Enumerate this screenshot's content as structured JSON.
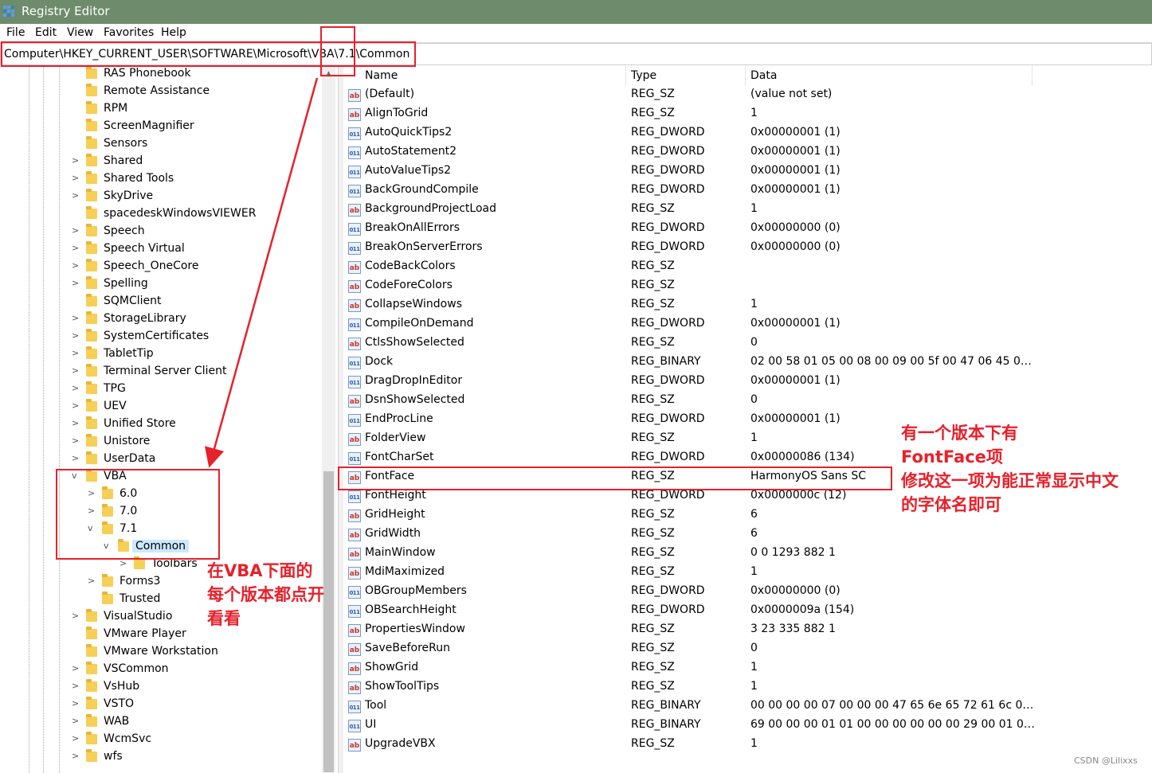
{
  "window": {
    "title": "Registry Editor"
  },
  "menu": [
    "File",
    "Edit",
    "View",
    "Favorites",
    "Help"
  ],
  "address": "Computer\\HKEY_CURRENT_USER\\SOFTWARE\\Microsoft\\VBA\\7.1\\Common",
  "tree": [
    {
      "label": "RAS Phonebook",
      "expandable": false
    },
    {
      "label": "Remote Assistance",
      "expandable": false
    },
    {
      "label": "RPM",
      "expandable": false
    },
    {
      "label": "ScreenMagnifier",
      "expandable": false
    },
    {
      "label": "Sensors",
      "expandable": false
    },
    {
      "label": "Shared",
      "expandable": true
    },
    {
      "label": "Shared Tools",
      "expandable": true
    },
    {
      "label": "SkyDrive",
      "expandable": true
    },
    {
      "label": "spacedeskWindowsVIEWER",
      "expandable": false
    },
    {
      "label": "Speech",
      "expandable": true
    },
    {
      "label": "Speech Virtual",
      "expandable": true
    },
    {
      "label": "Speech_OneCore",
      "expandable": true
    },
    {
      "label": "Spelling",
      "expandable": true
    },
    {
      "label": "SQMClient",
      "expandable": false
    },
    {
      "label": "StorageLibrary",
      "expandable": true
    },
    {
      "label": "SystemCertificates",
      "expandable": true
    },
    {
      "label": "TabletTip",
      "expandable": true
    },
    {
      "label": "Terminal Server Client",
      "expandable": true
    },
    {
      "label": "TPG",
      "expandable": true
    },
    {
      "label": "UEV",
      "expandable": true
    },
    {
      "label": "Unified Store",
      "expandable": true
    },
    {
      "label": "Unistore",
      "expandable": true
    },
    {
      "label": "UserData",
      "expandable": true
    },
    {
      "label": "VBA",
      "expandable": true,
      "expanded": true
    },
    {
      "label": "6.0",
      "expandable": true,
      "depth": 1
    },
    {
      "label": "7.0",
      "expandable": true,
      "depth": 1
    },
    {
      "label": "7.1",
      "expandable": true,
      "expanded": true,
      "depth": 1
    },
    {
      "label": "Common",
      "expandable": true,
      "expanded": true,
      "depth": 2,
      "selected": true
    },
    {
      "label": "Toolbars",
      "expandable": true,
      "depth": 3
    },
    {
      "label": "Forms3",
      "expandable": true,
      "depth": 1
    },
    {
      "label": "Trusted",
      "expandable": false,
      "depth": 1
    },
    {
      "label": "VisualStudio",
      "expandable": true
    },
    {
      "label": "VMware Player",
      "expandable": false
    },
    {
      "label": "VMware Workstation",
      "expandable": false
    },
    {
      "label": "VSCommon",
      "expandable": true
    },
    {
      "label": "VsHub",
      "expandable": true
    },
    {
      "label": "VSTO",
      "expandable": true
    },
    {
      "label": "WAB",
      "expandable": true
    },
    {
      "label": "WcmSvc",
      "expandable": true
    },
    {
      "label": "wfs",
      "expandable": true
    }
  ],
  "columns": {
    "name": "Name",
    "type": "Type",
    "data": "Data"
  },
  "values": [
    {
      "name": "(Default)",
      "type": "REG_SZ",
      "data": "(value not set)"
    },
    {
      "name": "AlignToGrid",
      "type": "REG_SZ",
      "data": "1"
    },
    {
      "name": "AutoQuickTips2",
      "type": "REG_DWORD",
      "data": "0x00000001 (1)"
    },
    {
      "name": "AutoStatement2",
      "type": "REG_DWORD",
      "data": "0x00000001 (1)"
    },
    {
      "name": "AutoValueTips2",
      "type": "REG_DWORD",
      "data": "0x00000001 (1)"
    },
    {
      "name": "BackGroundCompile",
      "type": "REG_DWORD",
      "data": "0x00000001 (1)"
    },
    {
      "name": "BackgroundProjectLoad",
      "type": "REG_SZ",
      "data": "1"
    },
    {
      "name": "BreakOnAllErrors",
      "type": "REG_DWORD",
      "data": "0x00000000 (0)"
    },
    {
      "name": "BreakOnServerErrors",
      "type": "REG_DWORD",
      "data": "0x00000000 (0)"
    },
    {
      "name": "CodeBackColors",
      "type": "REG_SZ",
      "data": ""
    },
    {
      "name": "CodeForeColors",
      "type": "REG_SZ",
      "data": ""
    },
    {
      "name": "CollapseWindows",
      "type": "REG_SZ",
      "data": "1"
    },
    {
      "name": "CompileOnDemand",
      "type": "REG_DWORD",
      "data": "0x00000001 (1)"
    },
    {
      "name": "CtlsShowSelected",
      "type": "REG_SZ",
      "data": "0"
    },
    {
      "name": "Dock",
      "type": "REG_BINARY",
      "data": "02 00 58 01 05 00 08 00 09 00 5f 00 47 06 45 04 ff 0..."
    },
    {
      "name": "DragDropInEditor",
      "type": "REG_DWORD",
      "data": "0x00000001 (1)"
    },
    {
      "name": "DsnShowSelected",
      "type": "REG_SZ",
      "data": "0"
    },
    {
      "name": "EndProcLine",
      "type": "REG_DWORD",
      "data": "0x00000001 (1)"
    },
    {
      "name": "FolderView",
      "type": "REG_SZ",
      "data": "1"
    },
    {
      "name": "FontCharSet",
      "type": "REG_DWORD",
      "data": "0x00000086 (134)"
    },
    {
      "name": "FontFace",
      "type": "REG_SZ",
      "data": "HarmonyOS Sans SC"
    },
    {
      "name": "FontHeight",
      "type": "REG_DWORD",
      "data": "0x0000000c (12)"
    },
    {
      "name": "GridHeight",
      "type": "REG_SZ",
      "data": "6"
    },
    {
      "name": "GridWidth",
      "type": "REG_SZ",
      "data": "6"
    },
    {
      "name": "MainWindow",
      "type": "REG_SZ",
      "data": "0 0 1293 882 1"
    },
    {
      "name": "MdiMaximized",
      "type": "REG_SZ",
      "data": "1"
    },
    {
      "name": "OBGroupMembers",
      "type": "REG_DWORD",
      "data": "0x00000000 (0)"
    },
    {
      "name": "OBSearchHeight",
      "type": "REG_DWORD",
      "data": "0x0000009a (154)"
    },
    {
      "name": "PropertiesWindow",
      "type": "REG_SZ",
      "data": "3 23 335 882 1"
    },
    {
      "name": "SaveBeforeRun",
      "type": "REG_SZ",
      "data": "0"
    },
    {
      "name": "ShowGrid",
      "type": "REG_SZ",
      "data": "1"
    },
    {
      "name": "ShowToolTips",
      "type": "REG_SZ",
      "data": "1"
    },
    {
      "name": "Tool",
      "type": "REG_BINARY",
      "data": "00 00 00 00 07 00 00 00 47 65 6e 65 72 61 6c 00 ff f..."
    },
    {
      "name": "UI",
      "type": "REG_BINARY",
      "data": "69 00 00 00 01 01 00 00 00 00 00 00 29 00 01 00 00..."
    },
    {
      "name": "UpgradeVBX",
      "type": "REG_SZ",
      "data": "1"
    }
  ],
  "annotations": {
    "left_note": [
      "在VBA下面的",
      "每个版本都点开",
      "看看"
    ],
    "right_note": [
      "有一个版本下有",
      "FontFace项",
      "修改这一项为能正常显示中文",
      "的字体名即可"
    ],
    "color": "#e8202a"
  },
  "watermark": "CSDN @Lilixxs"
}
